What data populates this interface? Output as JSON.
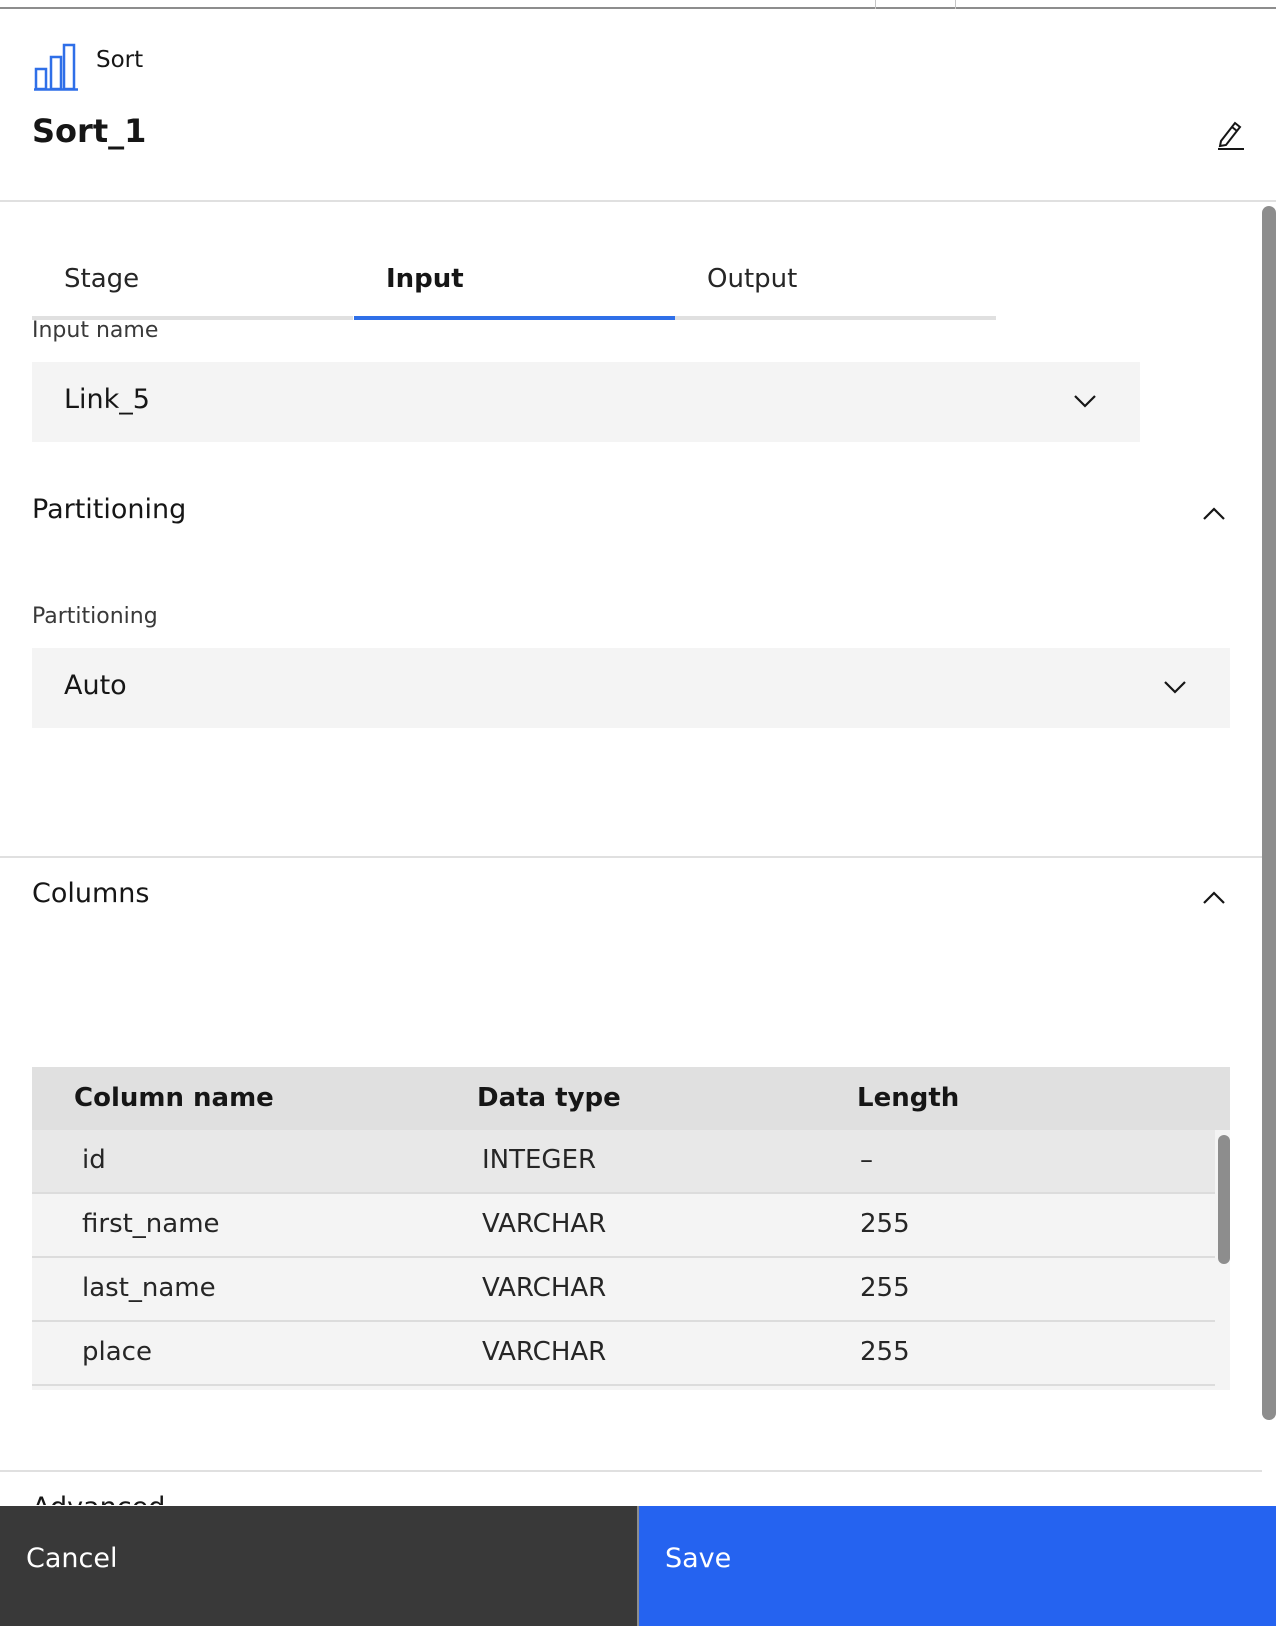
{
  "header": {
    "stage_type": "Sort",
    "stage_name": "Sort_1"
  },
  "tabs": [
    {
      "label": "Stage",
      "active": false
    },
    {
      "label": "Input",
      "active": true
    },
    {
      "label": "Output",
      "active": false
    }
  ],
  "input_name": {
    "label": "Input name",
    "value": "Link_5"
  },
  "partitioning_section": {
    "title": "Partitioning",
    "field_label": "Partitioning",
    "value": "Auto"
  },
  "columns_section": {
    "title": "Columns",
    "headers": [
      "Column name",
      "Data type",
      "Length"
    ],
    "rows": [
      {
        "name": "id",
        "type": "INTEGER",
        "length": "–"
      },
      {
        "name": "first_name",
        "type": "VARCHAR",
        "length": "255"
      },
      {
        "name": "last_name",
        "type": "VARCHAR",
        "length": "255"
      },
      {
        "name": "place",
        "type": "VARCHAR",
        "length": "255"
      }
    ]
  },
  "advanced_section": {
    "title": "Advanced"
  },
  "footer": {
    "cancel_label": "Cancel",
    "save_label": "Save"
  },
  "colors": {
    "accent": "#2f6fe8",
    "save_button": "#2563f0",
    "cancel_button": "#393939",
    "field_background": "#f4f4f4"
  },
  "icons": {
    "stage": "bar-chart-icon",
    "edit": "pencil-icon",
    "dropdown": "chevron-down-icon",
    "collapse": "chevron-up-icon"
  }
}
